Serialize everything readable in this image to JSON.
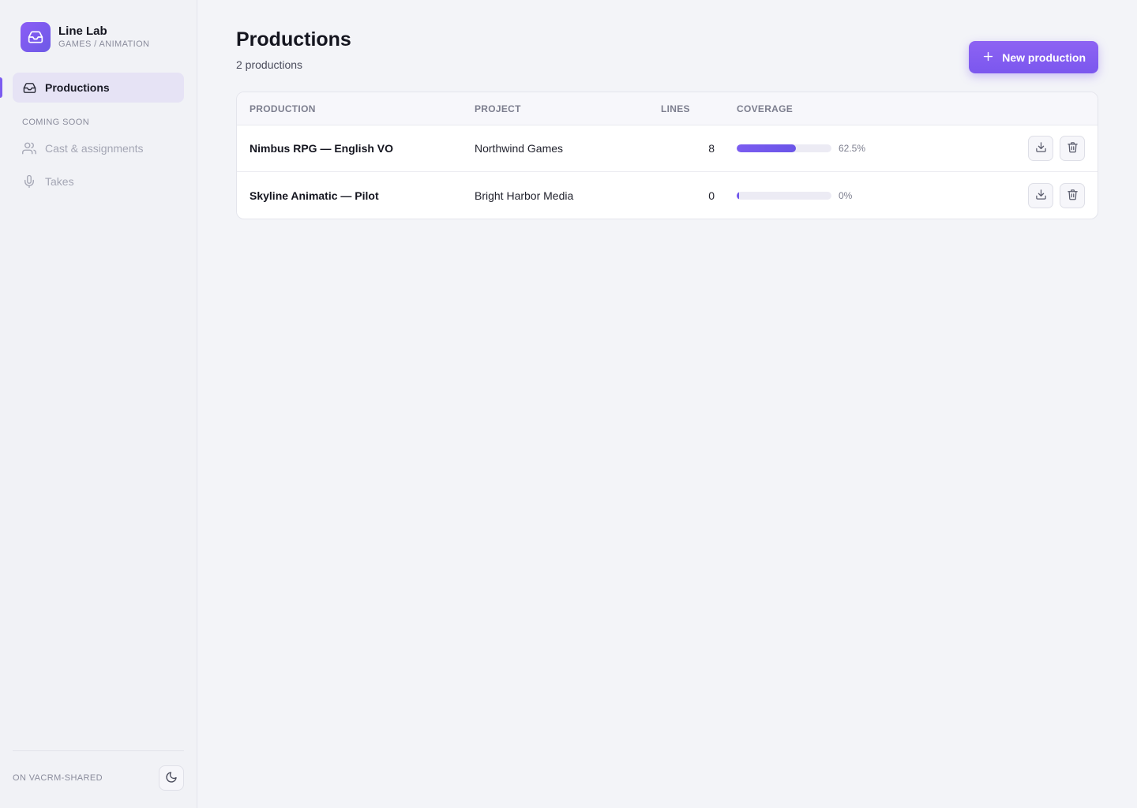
{
  "brand": {
    "name": "Line Lab",
    "subtitle": "GAMES / ANIMATION"
  },
  "sidebar": {
    "items": [
      {
        "label": "Productions",
        "active": true
      }
    ],
    "section_label": "COMING SOON",
    "soon_items": [
      {
        "label": "Cast & assignments"
      },
      {
        "label": "Takes"
      }
    ],
    "footer_label": "ON VACRM-SHARED"
  },
  "main": {
    "title": "Productions",
    "subtitle": "2 productions",
    "new_button_label": "New production"
  },
  "table": {
    "headers": [
      "PRODUCTION",
      "PROJECT",
      "LINES",
      "COVERAGE"
    ],
    "rows": [
      {
        "production": "Nimbus RPG — English VO",
        "project": "Northwind Games",
        "lines": "8",
        "coverage": 0.625,
        "coverage_label": "62.5%"
      },
      {
        "production": "Skyline Animatic — Pilot",
        "project": "Bright Harbor Media",
        "lines": "0",
        "coverage": 0,
        "coverage_label": "0%"
      }
    ]
  },
  "colors": {
    "accent": "#7c5cf0",
    "background": "#f3f4f8"
  },
  "icons": [
    "inbox-icon",
    "users-icon",
    "mic-icon",
    "moon-icon",
    "plus-icon",
    "download-icon",
    "trash-icon"
  ]
}
